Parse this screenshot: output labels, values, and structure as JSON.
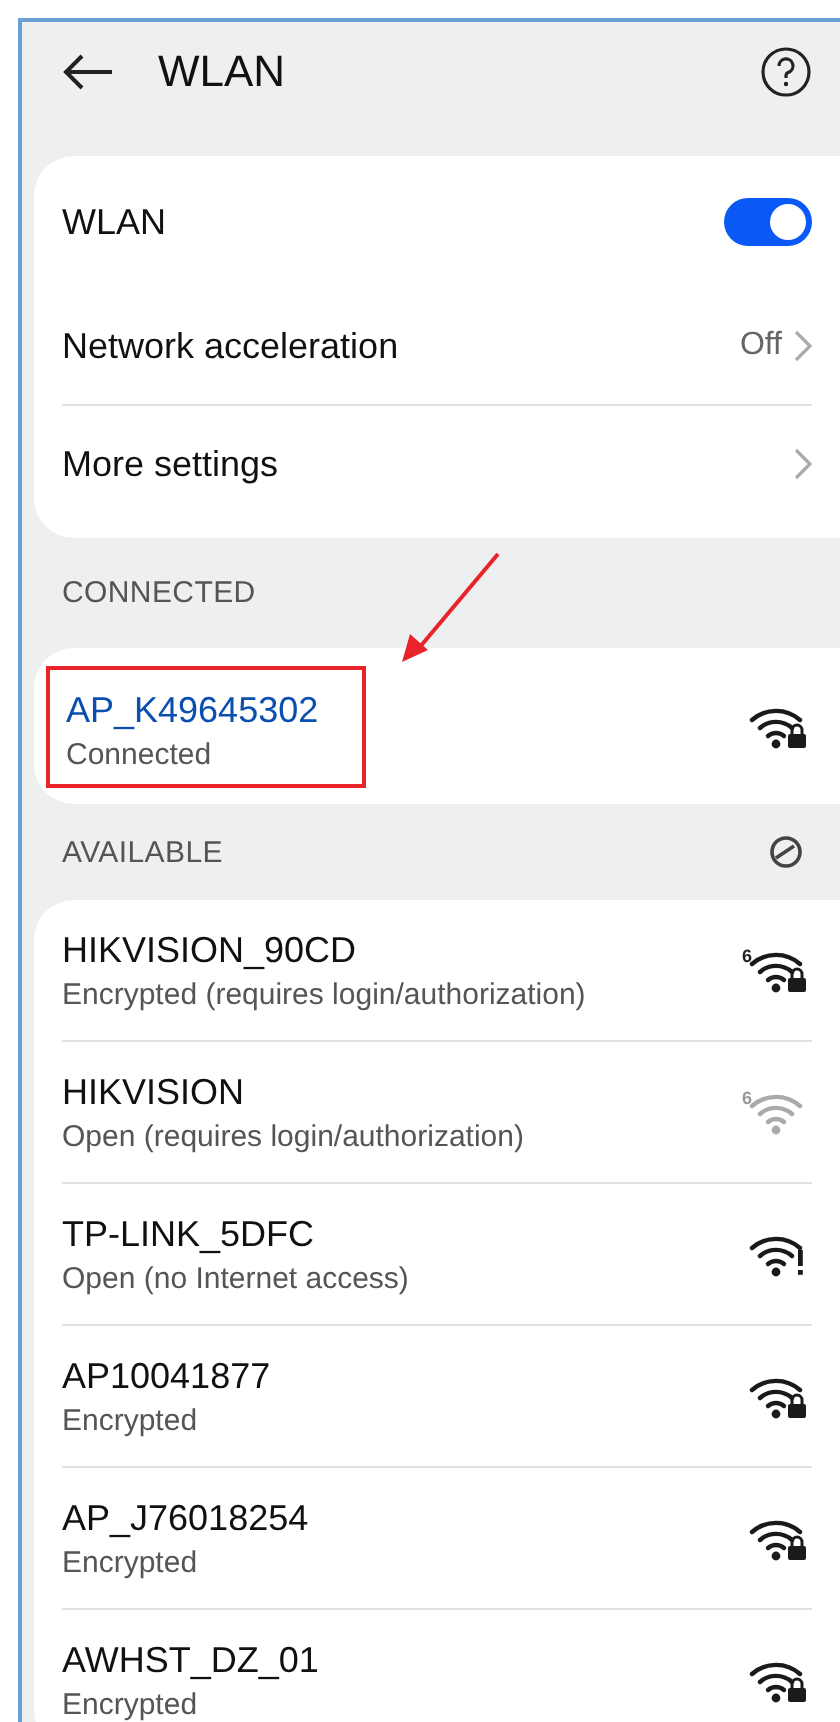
{
  "header": {
    "title": "WLAN"
  },
  "settings": [
    {
      "kind": "switch",
      "label": "WLAN",
      "on": true
    },
    {
      "kind": "link",
      "label": "Network acceleration",
      "value": "Off"
    },
    {
      "kind": "link",
      "label": "More settings"
    }
  ],
  "connected": {
    "heading": "CONNECTED",
    "network": {
      "name": "AP_K49645302",
      "status": "Connected",
      "kind": "locked",
      "dimmed": false,
      "highlighted": true
    }
  },
  "available": {
    "heading": "AVAILABLE",
    "networks": [
      {
        "name": "HIKVISION_90CD",
        "status": "Encrypted (requires login/authorization)",
        "kind": "locked",
        "badge": "6",
        "dimmed": false
      },
      {
        "name": "HIKVISION",
        "status": "Open (requires login/authorization)",
        "kind": "open",
        "badge": "6",
        "dimmed": true
      },
      {
        "name": "TP-LINK_5DFC",
        "status": "Open (no Internet access)",
        "kind": "warning",
        "dimmed": false
      },
      {
        "name": "AP10041877",
        "status": "Encrypted",
        "kind": "locked",
        "dimmed": false
      },
      {
        "name": "AP_J76018254",
        "status": "Encrypted",
        "kind": "locked",
        "dimmed": false
      },
      {
        "name": "AWHST_DZ_01",
        "status": "Encrypted",
        "kind": "locked",
        "dimmed": false
      }
    ]
  }
}
